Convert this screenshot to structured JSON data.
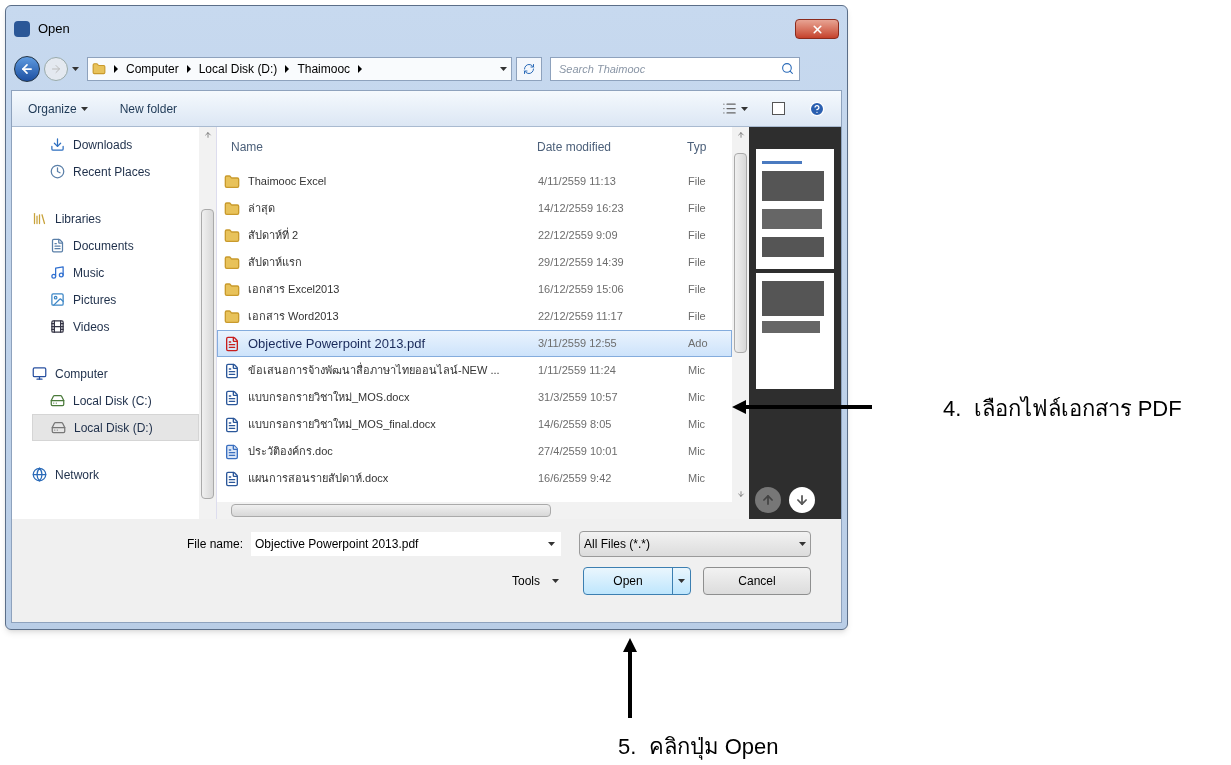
{
  "window": {
    "title": "Open"
  },
  "address_bar": {
    "path": [
      "Computer",
      "Local Disk (D:)",
      "Thaimooc"
    ]
  },
  "search": {
    "placeholder": "Search Thaimooc"
  },
  "toolbar": {
    "organize": "Organize",
    "new_folder": "New folder"
  },
  "sidebar": {
    "sections": [
      {
        "children": [
          {
            "label": "Downloads",
            "selected": false
          },
          {
            "label": "Recent Places",
            "selected": false
          }
        ]
      },
      {
        "label": "Libraries",
        "selected": false,
        "children": [
          {
            "label": "Documents",
            "selected": false
          },
          {
            "label": "Music",
            "selected": false
          },
          {
            "label": "Pictures",
            "selected": false
          },
          {
            "label": "Videos",
            "selected": false
          }
        ]
      },
      {
        "label": "Computer",
        "selected": false,
        "children": [
          {
            "label": "Local Disk (C:)",
            "selected": false
          },
          {
            "label": "Local Disk (D:)",
            "selected": true
          }
        ]
      },
      {
        "label": "Network",
        "selected": false
      }
    ]
  },
  "table": {
    "columns": [
      "Name",
      "Date modified",
      "Typ"
    ],
    "rows": [
      {
        "kind": "folder",
        "name": "Thaimooc Excel",
        "date": "4/11/2559 11:13",
        "type": "File",
        "selected": false
      },
      {
        "kind": "folder",
        "name": "ล่าสุด",
        "date": "14/12/2559 16:23",
        "type": "File",
        "selected": false
      },
      {
        "kind": "folder",
        "name": "สัปดาห์ที่ 2",
        "date": "22/12/2559 9:09",
        "type": "File",
        "selected": false
      },
      {
        "kind": "folder",
        "name": "สัปดาห์แรก",
        "date": "29/12/2559 14:39",
        "type": "File",
        "selected": false
      },
      {
        "kind": "folder",
        "name": "เอกสาร Excel2013",
        "date": "16/12/2559 15:06",
        "type": "File",
        "selected": false
      },
      {
        "kind": "folder",
        "name": "เอกสาร Word2013",
        "date": "22/12/2559 11:17",
        "type": "File",
        "selected": false
      },
      {
        "kind": "pdf",
        "name": "Objective Powerpoint 2013.pdf",
        "date": "3/11/2559 12:55",
        "type": "Ado",
        "selected": true
      },
      {
        "kind": "docx",
        "name": "ข้อเสนอการจ้างพัฒนาสื่อภาษาไทยออนไลน์-NEW ...",
        "date": "1/11/2559 11:24",
        "type": "Mic",
        "selected": false
      },
      {
        "kind": "docx",
        "name": "แบบกรอกรายวิชาใหม่_MOS.docx",
        "date": "31/3/2559 10:57",
        "type": "Mic",
        "selected": false
      },
      {
        "kind": "docx",
        "name": "แบบกรอกรายวิชาใหม่_MOS_final.docx",
        "date": "14/6/2559 8:05",
        "type": "Mic",
        "selected": false
      },
      {
        "kind": "doc",
        "name": "ประวัติองค์กร.doc",
        "date": "27/4/2559 10:01",
        "type": "Mic",
        "selected": false
      },
      {
        "kind": "docx",
        "name": "แผนการสอนรายสัปดาห์.docx",
        "date": "16/6/2559 9:42",
        "type": "Mic",
        "selected": false
      }
    ]
  },
  "file_name": {
    "label": "File name:",
    "value": "Objective Powerpoint 2013.pdf"
  },
  "file_type": {
    "value": "All Files (*.*)"
  },
  "tools": "Tools",
  "buttons": {
    "open": "Open",
    "cancel": "Cancel"
  },
  "annotations": [
    {
      "text": "4.  เลือกไฟล์เอกสาร PDF"
    },
    {
      "text": "5.  คลิกปุ่ม Open"
    }
  ]
}
